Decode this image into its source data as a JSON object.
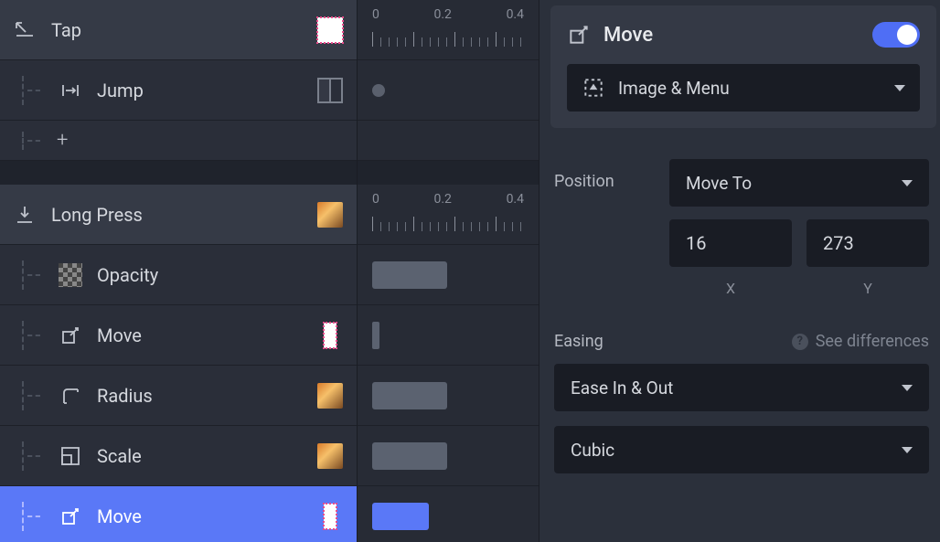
{
  "timeline_ruler": {
    "t0": "0",
    "t1": "0.2",
    "t2": "0.4"
  },
  "layers": {
    "tap": {
      "label": "Tap",
      "children": {
        "jump": {
          "label": "Jump"
        },
        "add": {
          "label": "+"
        }
      }
    },
    "longpress": {
      "label": "Long Press",
      "children": {
        "opacity": {
          "label": "Opacity"
        },
        "move1": {
          "label": "Move"
        },
        "radius": {
          "label": "Radius"
        },
        "scale": {
          "label": "Scale"
        },
        "move2": {
          "label": "Move"
        }
      }
    }
  },
  "inspector": {
    "title": "Move",
    "target": "Image & Menu",
    "position": {
      "label": "Position",
      "mode": "Move To",
      "x": "16",
      "y": "273",
      "x_label": "X",
      "y_label": "Y"
    },
    "easing": {
      "label": "Easing",
      "hint": "See differences",
      "type": "Ease In & Out",
      "curve": "Cubic"
    }
  }
}
